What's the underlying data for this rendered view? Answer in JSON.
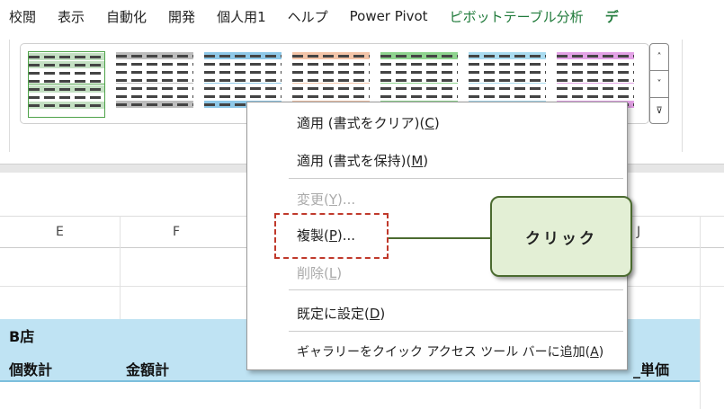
{
  "tabs": [
    "校閲",
    "表示",
    "自動化",
    "開発",
    "個人用1",
    "ヘルプ",
    "Power Pivot",
    "ピボットテーブル分析",
    "デ"
  ],
  "gallery": {
    "styles": [
      {
        "color": "#4fa34a"
      },
      {
        "color": "#bdbdbd"
      },
      {
        "color": "#8ec8e8"
      },
      {
        "color": "#f3c4a8"
      },
      {
        "color": "#8fd48f"
      },
      {
        "color": "#a9dbf0"
      },
      {
        "color": "#e3a2e6"
      }
    ],
    "scroll_up": "˄",
    "scroll_down": "˅",
    "more": "⊽"
  },
  "columns": {
    "e": "E",
    "f": "F",
    "j": "J"
  },
  "table": {
    "store": "B店",
    "h1": "個数計",
    "h2": "金額計",
    "h3": "_単価"
  },
  "menu": {
    "apply_clear": "適用 (書式をクリア)(",
    "apply_clear_key": "C",
    "apply_keep": "適用 (書式を保持)(",
    "apply_keep_key": "M",
    "modify": "変更(",
    "modify_key": "Y",
    "modify_end": ")...",
    "duplicate": "複製(",
    "duplicate_key": "P",
    "duplicate_end": ")...",
    "delete": "削除(",
    "delete_key": "L",
    "set_default": "既定に設定(",
    "set_default_key": "D",
    "add_qat": "ギャラリーをクイック アクセス ツール バーに追加(",
    "add_qat_key": "A",
    "close": ")"
  },
  "callout": "クリック",
  "colors": {
    "highlight": "#c0392b",
    "callout_fill": "#e3efd5",
    "header_fill": "#bfe3f3"
  }
}
